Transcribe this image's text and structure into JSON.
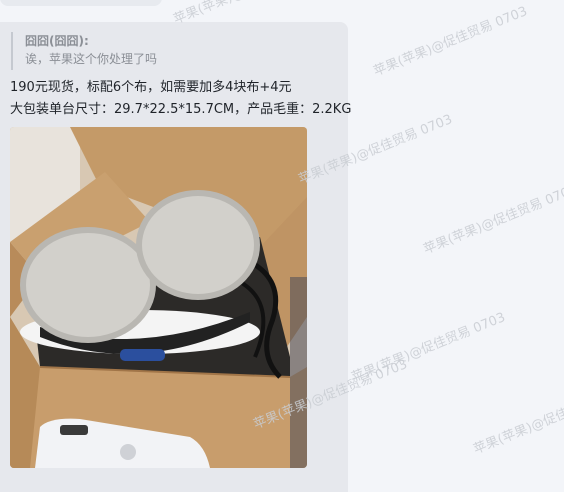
{
  "quote": {
    "author": "囧囧(囧囧):",
    "text": "诶，苹果这个你处理了吗"
  },
  "message": {
    "line1": "190元现货，标配6个布，如需要加多4块布+4元",
    "line2": "大包装单台尺寸：29.7*22.5*15.7CM，产品毛重：2.2KG"
  },
  "photo": {
    "description_icon": "product-photo"
  },
  "watermarks": [
    "苹果(苹果)@...",
    "苹果(苹果)@促佳贸易 0703",
    "苹果(苹果)@促佳贸易 0703",
    "苹果(苹果)@促佳贸易 0703",
    "苹果(苹果)@促佳贸易 0703",
    "苹果(苹果)@促佳贸易 0703",
    "苹果(苹果)@促佳贸易 0703",
    "贸易 0703",
    "@促佳贸易 0703",
    "@促佳贸易"
  ],
  "colors": {
    "background": "#f3f5f9",
    "bubble": "#e6e8ed",
    "text": "#1f2329",
    "quote_text": "#8b8f96"
  }
}
